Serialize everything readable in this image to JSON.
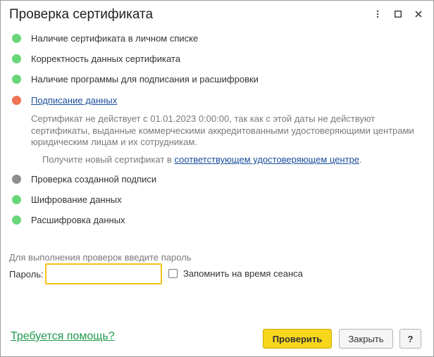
{
  "window": {
    "title": "Проверка сертификата",
    "menu_icon": "more-vertical-icon",
    "maximize_icon": "maximize-icon",
    "close_icon": "close-icon"
  },
  "checks": [
    {
      "label": "Наличие сертификата в личном списке",
      "status": "ok"
    },
    {
      "label": "Корректность данных сертификата",
      "status": "ok"
    },
    {
      "label": "Наличие программы для подписания и расшифровки",
      "status": "ok"
    },
    {
      "label": "Подписание данных",
      "status": "error"
    },
    {
      "label": "Проверка созданной подписи",
      "status": "not-checked"
    },
    {
      "label": "Шифрование данных",
      "status": "ok"
    },
    {
      "label": "Расшифровка данных",
      "status": "ok"
    }
  ],
  "error": {
    "text": "Сертификат не действует с 01.01.2023 0:00:00, так как с этой даты не действуют сертификаты, выданные коммерческими аккредитованными удостоверяющими центрами юридическим лицам и их сотрудникам.",
    "hint_prefix": "Получите новый сертификат в ",
    "hint_link": "соответствующем удостоверяющем центре",
    "hint_suffix": "."
  },
  "password": {
    "caption": "Для выполнения проверок введите пароль",
    "label": "Пароль:",
    "value": "",
    "remember_label": "Запомнить на время сеанса",
    "remember_checked": false
  },
  "footer": {
    "help_link": "Требуется помощь?",
    "check_button": "Проверить",
    "close_button": "Закрыть",
    "help_button": "?"
  },
  "colors": {
    "ok": "#6ad67a",
    "error": "#ef7355",
    "not_checked": "#8e8e8e",
    "primary_button": "#f7d61c",
    "input_focus": "#f5c118",
    "link": "#1a4e9c",
    "help_link": "#1f9a4c"
  }
}
